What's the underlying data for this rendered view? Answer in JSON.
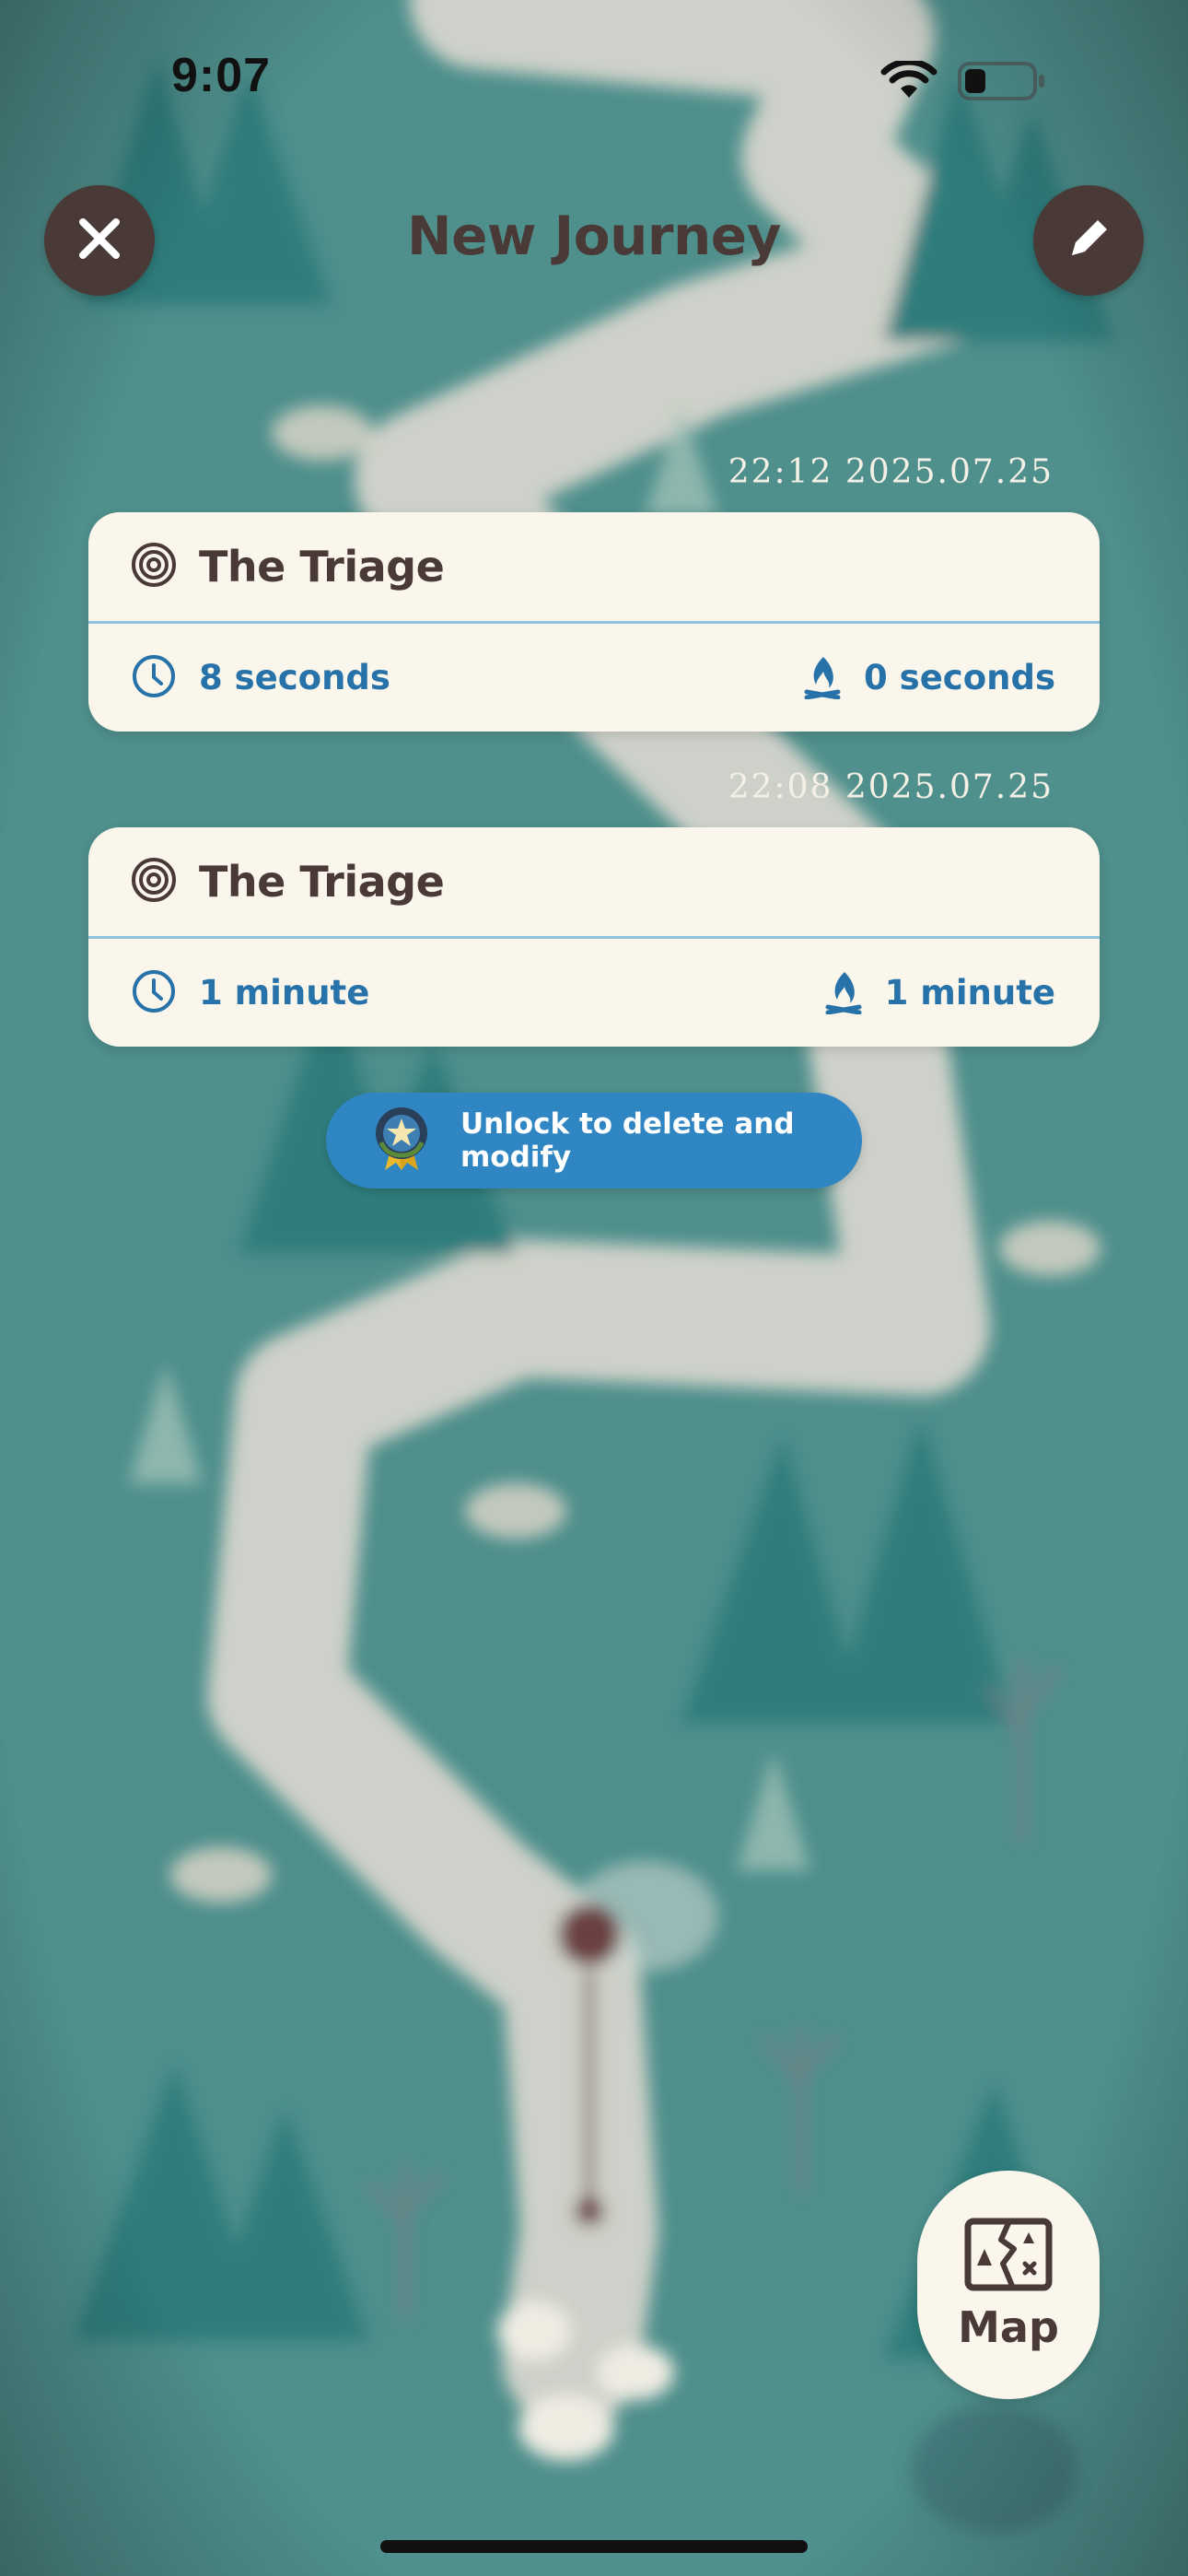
{
  "status_bar": {
    "time": "9:07"
  },
  "header": {
    "title": "New Journey"
  },
  "entries": [
    {
      "timestamp": "22:12 2025.07.25",
      "title": "The Triage",
      "focus_duration": "8 seconds",
      "rest_duration": "0 seconds"
    },
    {
      "timestamp": "22:08 2025.07.25",
      "title": "The Triage",
      "focus_duration": "1 minute",
      "rest_duration": "1 minute"
    }
  ],
  "unlock": {
    "label": "Unlock to delete and modify"
  },
  "map_button": {
    "label": "Map"
  },
  "icons": {
    "close": "close-icon",
    "edit": "pencil-icon",
    "target": "target-icon",
    "clock": "clock-icon",
    "campfire": "campfire-icon",
    "badge": "star-badge-icon",
    "map": "map-icon"
  },
  "colors": {
    "background": "#4e8f8c",
    "card": "#faf6ec",
    "accent_blue": "#2672a9",
    "pill_blue": "#2f86c2",
    "dark_brown": "#4a3a37"
  }
}
